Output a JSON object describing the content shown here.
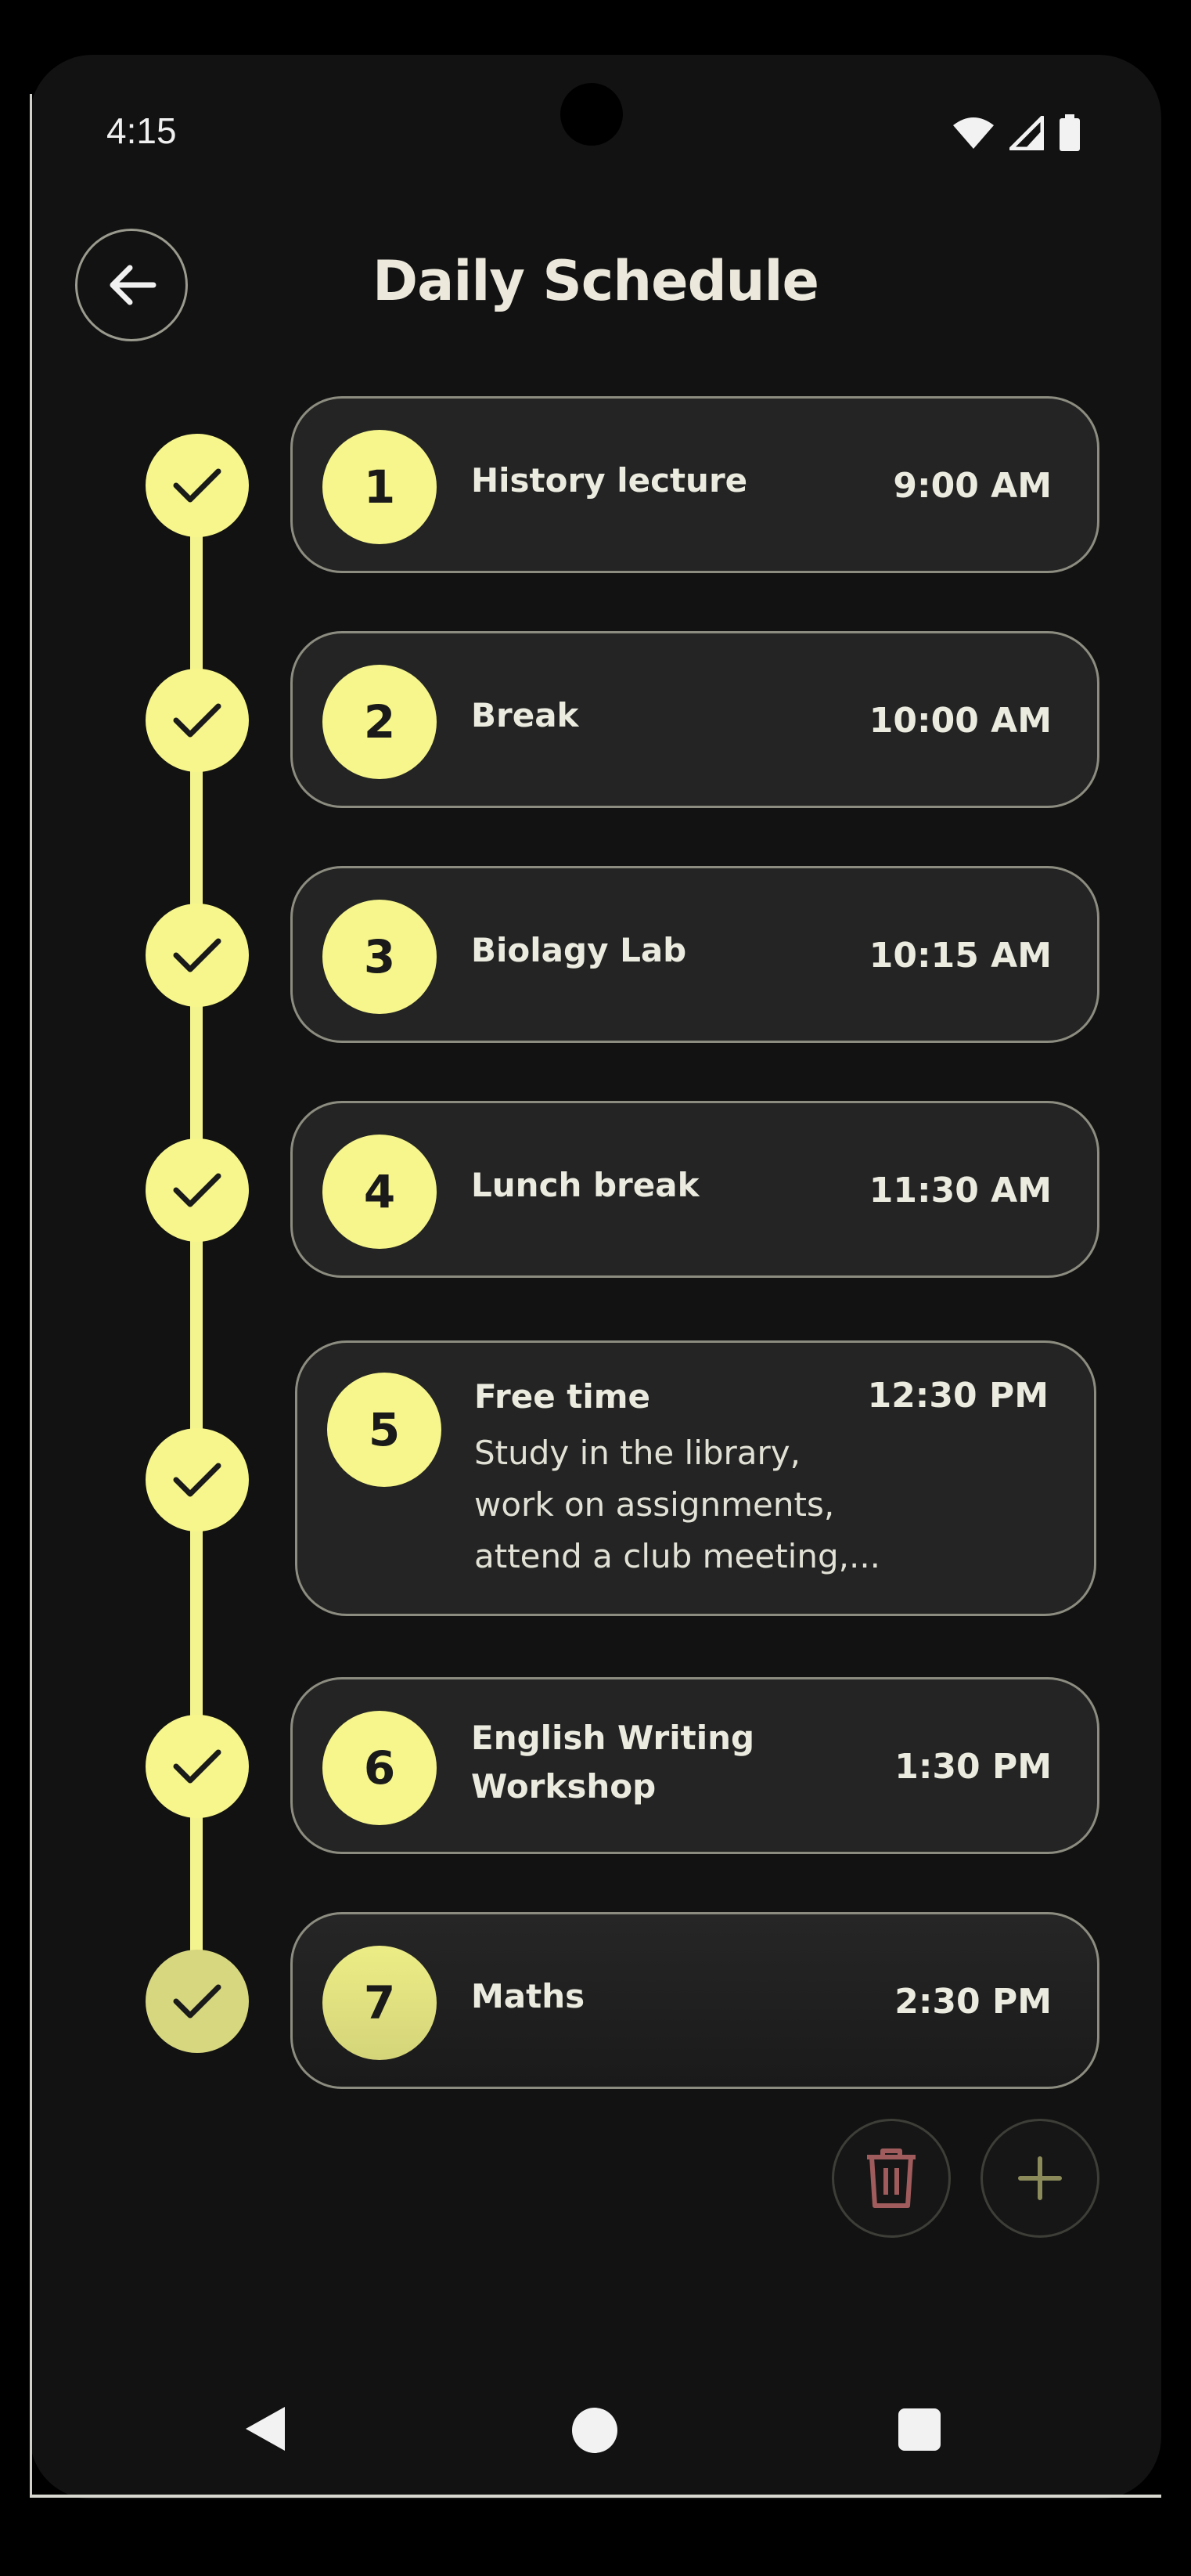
{
  "status_bar": {
    "time": "4:15",
    "icons": [
      "wifi-icon",
      "cell-signal-icon",
      "battery-icon"
    ]
  },
  "header": {
    "title": "Daily Schedule",
    "back_icon": "arrow-left-icon"
  },
  "colors": {
    "accent": "#f6f68c",
    "background": "#121212",
    "card": "#242424",
    "card_border": "#8c8c80",
    "text": "#ecebe0",
    "delete": "#a05c5c",
    "add": "#8a8a5a"
  },
  "schedule": [
    {
      "number": "1",
      "title": "History lecture",
      "time": "9:00 AM",
      "done": true
    },
    {
      "number": "2",
      "title": "Break",
      "time": "10:00 AM",
      "done": true
    },
    {
      "number": "3",
      "title": "Biolagy Lab",
      "time": "10:15 AM",
      "done": true
    },
    {
      "number": "4",
      "title": "Lunch break",
      "time": "11:30 AM",
      "done": true
    },
    {
      "number": "5",
      "title": "Free time",
      "time": "12:30 PM",
      "done": true,
      "description": [
        "Study in the library,",
        "work on assignments,",
        "attend a club meeting,..."
      ]
    },
    {
      "number": "6",
      "title": "English Writing Workshop",
      "title_lines": [
        "English Writing",
        "Workshop"
      ],
      "time": "1:30 PM",
      "done": true
    },
    {
      "number": "7",
      "title": "Maths",
      "time": "2:30 PM",
      "done": true
    }
  ],
  "actions": {
    "delete_icon": "trash-icon",
    "add_icon": "plus-icon"
  },
  "nav_bar": {
    "icons": [
      "nav-back-icon",
      "nav-home-icon",
      "nav-recents-icon"
    ]
  }
}
